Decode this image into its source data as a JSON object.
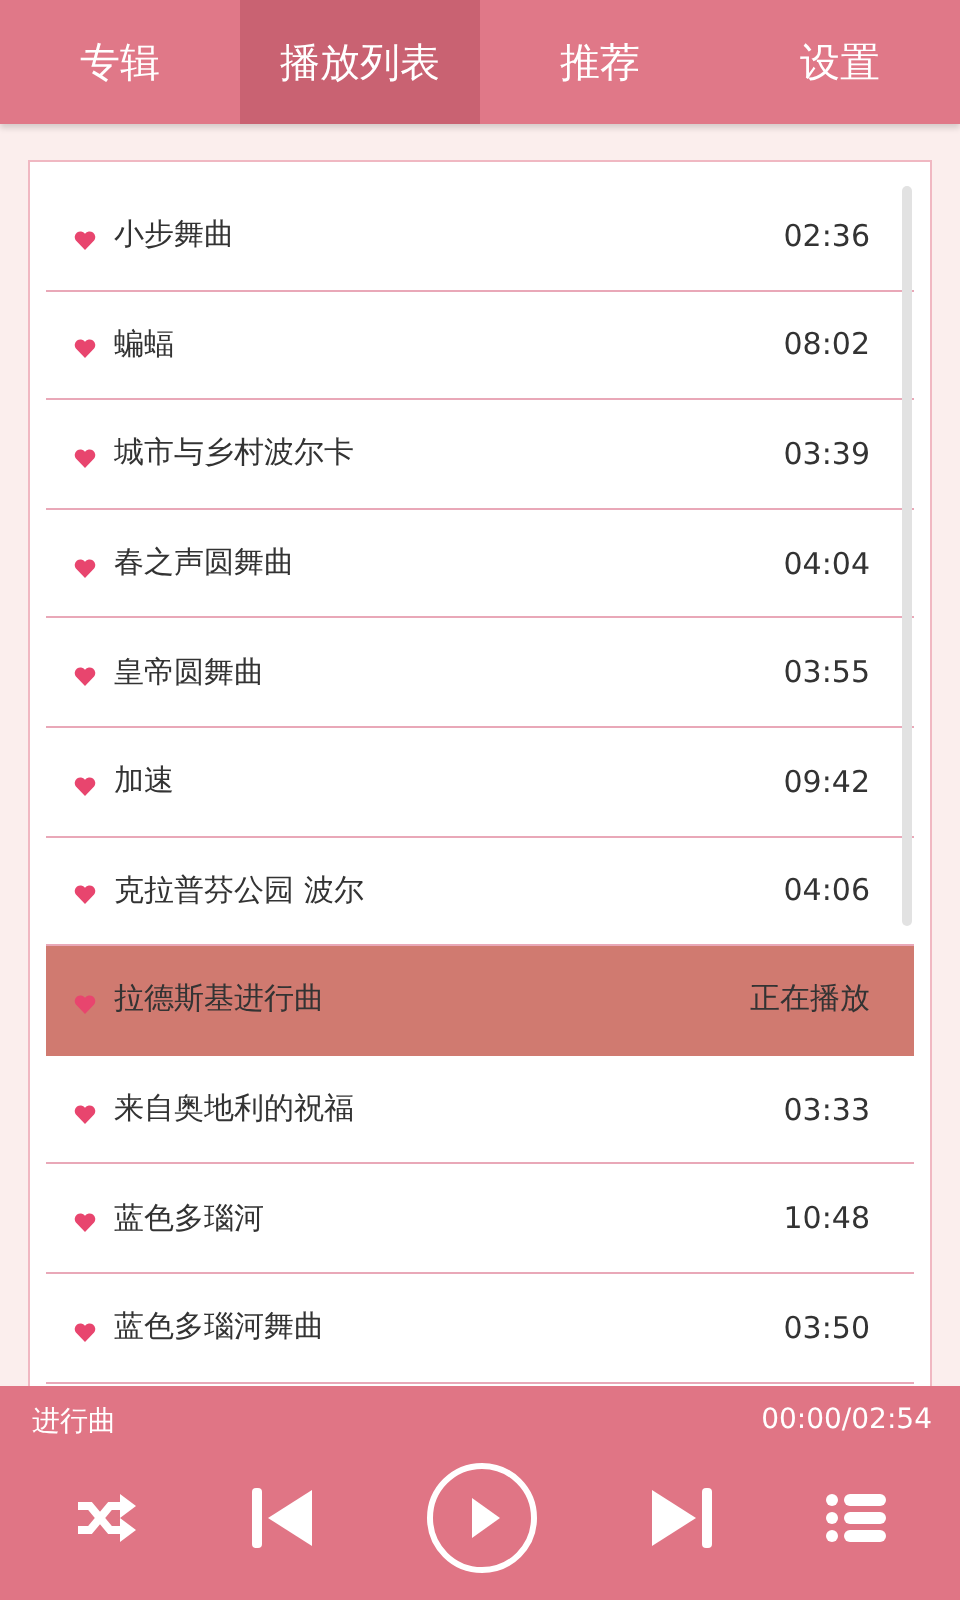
{
  "tabs": [
    {
      "label": "专辑",
      "selected": false
    },
    {
      "label": "播放列表",
      "selected": true
    },
    {
      "label": "推荐",
      "selected": false
    },
    {
      "label": "设置",
      "selected": false
    }
  ],
  "playlist": [
    {
      "title": "小步舞曲",
      "duration": "02:36",
      "selected": false
    },
    {
      "title": "蝙蝠",
      "duration": "08:02",
      "selected": false
    },
    {
      "title": "城市与乡村波尔卡",
      "duration": "03:39",
      "selected": false
    },
    {
      "title": "春之声圆舞曲",
      "duration": "04:04",
      "selected": false
    },
    {
      "title": "皇帝圆舞曲",
      "duration": "03:55",
      "selected": false
    },
    {
      "title": "加速",
      "duration": "09:42",
      "selected": false
    },
    {
      "title": "克拉普芬公园 波尔",
      "duration": "04:06",
      "selected": false
    },
    {
      "title": "拉德斯基进行曲",
      "duration": "正在播放",
      "selected": true
    },
    {
      "title": "来自奥地利的祝福",
      "duration": "03:33",
      "selected": false
    },
    {
      "title": "蓝色多瑙河",
      "duration": "10:48",
      "selected": false
    },
    {
      "title": "蓝色多瑙河舞曲",
      "duration": "03:50",
      "selected": false
    }
  ],
  "player": {
    "now_playing": "进行曲",
    "time": "00:00/02:54"
  }
}
